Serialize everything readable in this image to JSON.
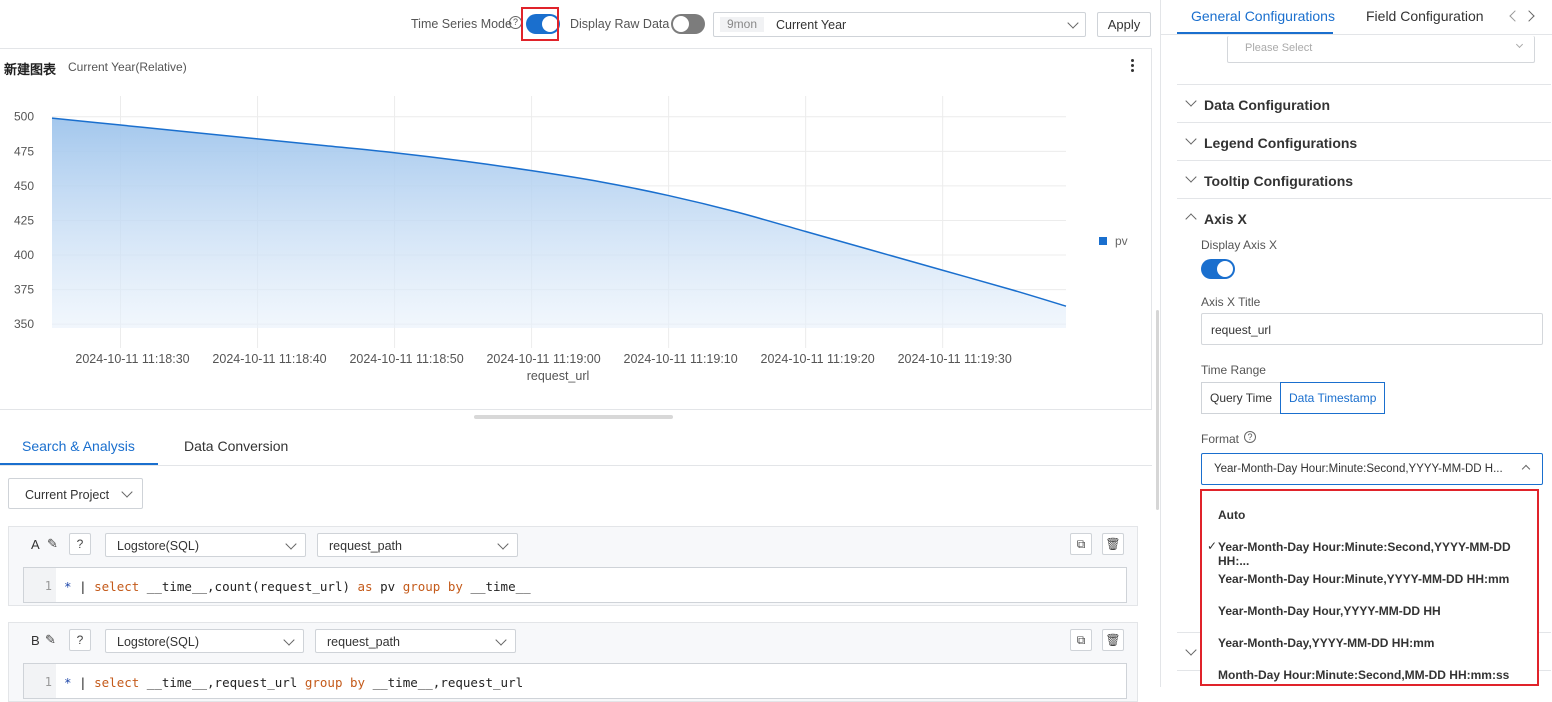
{
  "toolbar": {
    "time_series_label": "Time Series Mode",
    "time_series_on": true,
    "raw_data_label": "Display Raw Data",
    "raw_data_on": false,
    "time_tag": "9mon",
    "time_value": "Current Year",
    "apply_label": "Apply"
  },
  "chart_card": {
    "title": "新建图表",
    "subtitle": "Current Year(Relative)"
  },
  "chart_data": {
    "type": "area",
    "xlabel": "request_url",
    "ylabel": "",
    "ylim": [
      340,
      515
    ],
    "y_ticks": [
      350,
      375,
      400,
      425,
      450,
      475,
      500
    ],
    "x_ticks": [
      "2024-10-11 11:18:30",
      "2024-10-11 11:18:40",
      "2024-10-11 11:18:50",
      "2024-10-11 11:19:00",
      "2024-10-11 11:19:10",
      "2024-10-11 11:19:20",
      "2024-10-11 11:19:30"
    ],
    "x_seconds": [
      0,
      5,
      10,
      15,
      20,
      25,
      30,
      35,
      40,
      45,
      50,
      55,
      60,
      65,
      70,
      74
    ],
    "x_start": "2024-10-11 11:18:26",
    "series": [
      {
        "name": "pv",
        "color": "#1a6fce",
        "values": [
          499,
          494,
          489,
          484,
          479,
          474,
          468,
          461,
          453,
          443,
          431,
          417,
          403,
          389,
          375,
          363
        ]
      }
    ],
    "legend_position": "right",
    "grid": true
  },
  "lower": {
    "tabs": [
      "Search & Analysis",
      "Data Conversion"
    ],
    "active_tab": 0,
    "project_select": "Current Project",
    "queries": [
      {
        "id": "A",
        "store": "Logstore(SQL)",
        "logstore": "request_path",
        "line": "1",
        "code_parts": [
          "* ",
          "| ",
          "select",
          " __time__,count(request_url) ",
          "as",
          " pv ",
          "group by",
          " __time__"
        ]
      },
      {
        "id": "B",
        "store": "Logstore(SQL)",
        "logstore": "request_path",
        "line": "1",
        "code_parts": [
          "* ",
          "| ",
          "select",
          " __time__,request_url ",
          "group by",
          " __time__,request_url"
        ]
      }
    ]
  },
  "right_panel": {
    "tabs": [
      "General Configurations",
      "Field Configuration"
    ],
    "active_tab": 0,
    "top_select_placeholder": "Please Select",
    "sections": [
      "Data Configuration",
      "Legend Configurations",
      "Tooltip Configurations"
    ],
    "axis_x": {
      "header": "Axis X",
      "display_label": "Display Axis X",
      "display_on": true,
      "title_label": "Axis X Title",
      "title_value": "request_url",
      "time_range_label": "Time Range",
      "time_range_options": [
        "Query Time",
        "Data Timestamp"
      ],
      "time_range_selected": 1,
      "format_label": "Format",
      "format_value": "Year-Month-Day Hour:Minute:Second,YYYY-MM-DD H...",
      "format_options": [
        "Auto",
        "Year-Month-Day Hour:Minute:Second,YYYY-MM-DD HH:...",
        "Year-Month-Day Hour:Minute,YYYY-MM-DD HH:mm",
        "Year-Month-Day Hour,YYYY-MM-DD HH",
        "Year-Month-Day,YYYY-MM-DD HH:mm",
        "Month-Day Hour:Minute:Second,MM-DD HH:mm:ss"
      ],
      "format_selected": 1
    }
  },
  "colors": {
    "accent": "#1a6fce",
    "highlight": "#e0232a"
  }
}
